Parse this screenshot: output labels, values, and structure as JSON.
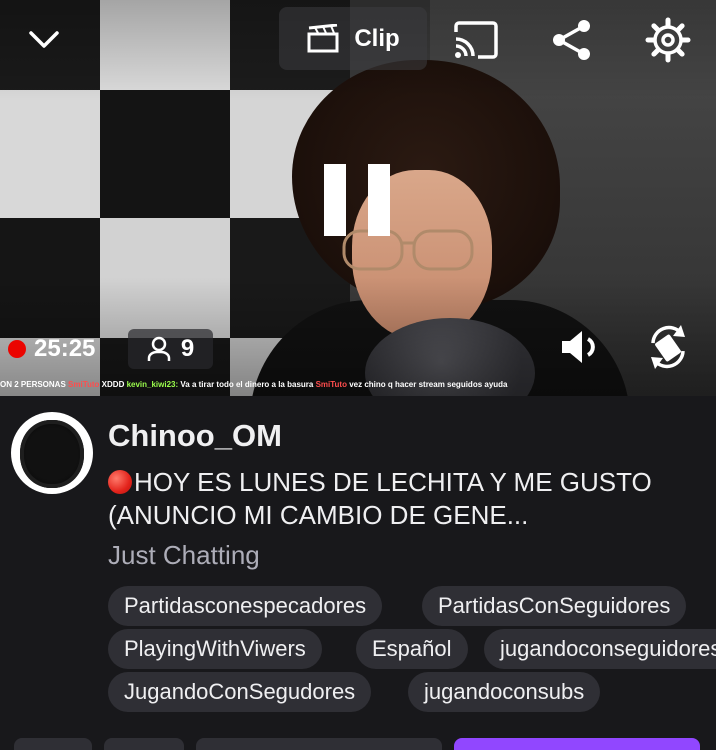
{
  "player": {
    "clip_label": "Clip",
    "live_time": "25:25",
    "viewer_count": "9",
    "ticker": {
      "part1": "ON 2 PERSONAS",
      "user1": "SmiTuto",
      "msg1": "XDDD",
      "user2": "kevin_kiwi23:",
      "msg2": "Va a tirar todo el dinero a la basura",
      "user3": "SmiTuto",
      "msg3": "vez chino q hacer stream seguidos ayuda"
    },
    "colors": {
      "live": "#eb0400",
      "follow": "#9147ff"
    },
    "icons": [
      "chevron-down-icon",
      "clip-icon",
      "cast-icon",
      "share-icon",
      "gear-icon",
      "pause-icon",
      "person-icon",
      "volume-icon",
      "rotate-icon"
    ]
  },
  "channel": {
    "name": "Chinoo_OM",
    "title": "HOY ES LUNES DE LECHITA Y ME GUSTO (ANUNCIO MI CAMBIO DE GENE...",
    "category": "Just Chatting",
    "tags": [
      "Partidasconespecadores",
      "PartidasConSeguidores",
      "PlayingWithViwers",
      "Español",
      "jugandoconseguidores",
      "JugandoConSegudores",
      "jugandoconsubs"
    ]
  }
}
